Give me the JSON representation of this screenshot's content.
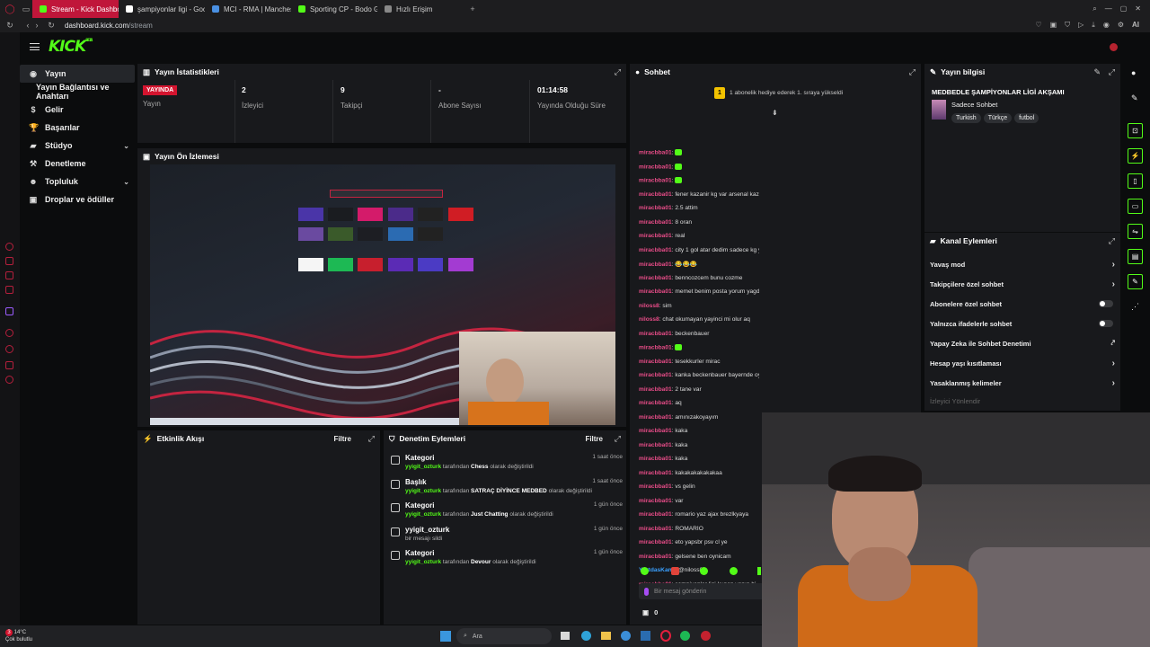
{
  "browser": {
    "tabs": [
      {
        "label": "Stream - Kick Dashboard",
        "active": true,
        "color": "#53fc18"
      },
      {
        "label": "şampiyonlar ligi - Google",
        "active": false,
        "color": "#ffffff"
      },
      {
        "label": "MCI - RMA | Manchester",
        "active": false,
        "color": "#4a90e2"
      },
      {
        "label": "Sporting CP - Bodo Glimt",
        "active": false,
        "color": "#53fc18"
      },
      {
        "label": "Hızlı Erişim",
        "active": false,
        "color": "#888888"
      }
    ],
    "url_host": "dashboard.kick.com",
    "url_path": "/stream"
  },
  "kick": {
    "logo": "KICK",
    "logo_badge": "BETA"
  },
  "leftnav": [
    {
      "label": "Yayın",
      "icon": "broadcast-icon",
      "selected": true
    },
    {
      "label": "Yayın Bağlantısı ve Anahtarı",
      "icon": "",
      "selected": false
    },
    {
      "label": "Gelir",
      "icon": "dollar-icon",
      "selected": false
    },
    {
      "label": "Başarılar",
      "icon": "trophy-icon",
      "selected": false
    },
    {
      "label": "Stüdyo",
      "icon": "studio-icon",
      "selected": false,
      "chevron": true
    },
    {
      "label": "Denetleme",
      "icon": "hammer-icon",
      "selected": false
    },
    {
      "label": "Topluluk",
      "icon": "community-icon",
      "selected": false,
      "chevron": true
    },
    {
      "label": "Droplar ve ödüller",
      "icon": "gift-icon",
      "selected": false
    }
  ],
  "stats": {
    "title": "Yayın İstatistikleri",
    "status_badge": "YAYINDA",
    "status_label": "Yayın",
    "viewers": "2",
    "viewers_label": "İzleyici",
    "followers": "9",
    "followers_label": "Takipçi",
    "subs": "-",
    "subs_label": "Abone Sayısı",
    "uptime": "01:14:58",
    "uptime_label": "Yayında Olduğu Süre"
  },
  "preview": {
    "title": "Yayın Ön İzlemesi"
  },
  "activity": {
    "title": "Etkinlik Akışı",
    "filter": "Filtre"
  },
  "mod": {
    "title": "Denetim Eylemleri",
    "filter": "Filtre",
    "items": [
      {
        "title": "Kategori",
        "user": "yyigit_ozturk",
        "mid": "tarafından",
        "value": "Chess",
        "end": "olarak değiştirildi",
        "time": "1 saat önce"
      },
      {
        "title": "Başlık",
        "user": "yyigit_ozturk",
        "mid": "tarafından",
        "value": "SATRAÇ DİYİNCE MEDBED",
        "end": "olarak değiştirildi",
        "time": "1 saat önce"
      },
      {
        "title": "Kategori",
        "user": "yyigit_ozturk",
        "mid": "tarafından",
        "value": "Just Chatting",
        "end": "olarak değiştirildi",
        "time": "1 gün önce"
      },
      {
        "title": "yyigit_ozturk",
        "user": "",
        "mid": "bir mesajı sildi",
        "value": "",
        "end": "",
        "time": "1 gün önce"
      },
      {
        "title": "Kategori",
        "user": "yyigit_ozturk",
        "mid": "tarafından",
        "value": "Devour",
        "end": "olarak değiştirildi",
        "time": "1 gün önce"
      }
    ]
  },
  "chat": {
    "title": "Sohbet",
    "pinned": "1 abonelik hediye ederek 1. sıraya yükseldi",
    "pinned_rank": "1",
    "messages": [
      {
        "user": "miracbba01",
        "text": "",
        "emote": true
      },
      {
        "user": "miracbba01",
        "text": "",
        "emote": true
      },
      {
        "user": "miracbba01",
        "text": "",
        "emote": true
      },
      {
        "user": "miracbba01",
        "text": "fener kazanir kg var arsenal kazanir 1.5 ust city 0.5 ust psg kg var",
        "emote": false
      },
      {
        "user": "miracbba01",
        "text": "2.5 attim",
        "emote": false
      },
      {
        "user": "miracbba01",
        "text": "8 oran",
        "emote": false
      },
      {
        "user": "miracbba01",
        "text": "real",
        "emote": false
      },
      {
        "user": "miracbba01",
        "text": "city 1 gol atar dedim sadece kg yok o maca",
        "emote": false
      },
      {
        "user": "miracbba01",
        "text": "😂😂😂",
        "emote": false
      },
      {
        "user": "miracbba01",
        "text": "benncozcem bunu cozme",
        "emote": false
      },
      {
        "user": "miracbba01",
        "text": "memet benim posta yorum yagdirlyo anlik senin elemanlar",
        "emote": false
      },
      {
        "user": "niloss8",
        "text": "sim",
        "emote": false
      },
      {
        "user": "niloss8",
        "text": "chat okumayan yayinci mi olur aq",
        "emote": false
      },
      {
        "user": "miracbba01",
        "text": "beckenbauer",
        "emote": false
      },
      {
        "user": "miracbba01",
        "text": "",
        "emote": true
      },
      {
        "user": "miracbba01",
        "text": "tesekkurler mirac",
        "emote": false
      },
      {
        "user": "miracbba01",
        "text": "kanka beckenbauer bayernde oynadi ballondoru da var aq",
        "emote": false
      },
      {
        "user": "miracbba01",
        "text": "2 tane var",
        "emote": false
      },
      {
        "user": "miracbba01",
        "text": "aq",
        "emote": false
      },
      {
        "user": "miracbba01",
        "text": "amınızakoyayım",
        "emote": false
      },
      {
        "user": "miracbba01",
        "text": "kaka",
        "emote": false
      },
      {
        "user": "miracbba01",
        "text": "kaka",
        "emote": false
      },
      {
        "user": "miracbba01",
        "text": "kaka",
        "emote": false
      },
      {
        "user": "miracbba01",
        "text": "kakakakakakakaa",
        "emote": false
      },
      {
        "user": "miracbba01",
        "text": "vs gelin",
        "emote": false
      },
      {
        "user": "miracbba01",
        "text": "var",
        "emote": false
      },
      {
        "user": "miracbba01",
        "text": "romario yaz ajax brezlkyaya",
        "emote": false
      },
      {
        "user": "miracbba01",
        "text": "ROMARİO",
        "emote": false
      },
      {
        "user": "miracbba01",
        "text": "eto yapsbr psv cl ye",
        "emote": false
      },
      {
        "user": "miracbba01",
        "text": "gelsene ben oynicam",
        "emote": false
      },
      {
        "user": "YurtdasKane",
        "text": "@niloss8",
        "emote": false,
        "alt": true
      },
      {
        "user": "miracbba01",
        "text": "şampiyonlar ligi kupon yapın bi",
        "emote": false
      }
    ],
    "placeholder": "Bir mesaj gönderin",
    "count": "0"
  },
  "info": {
    "title": "Yayın bilgisi",
    "stream_title": "MEDBEDLE ŞAMPİYONLAR LİGİ AKŞAMI",
    "category": "Sadece Sohbet",
    "tags": [
      "Turkish",
      "Türkçe",
      "futbol"
    ]
  },
  "channel_actions": {
    "title": "Kanal Eylemleri",
    "items": [
      {
        "label": "Yavaş mod",
        "type": "chevron"
      },
      {
        "label": "Takipçilere özel sohbet",
        "type": "chevron"
      },
      {
        "label": "Abonelere özel sohbet",
        "type": "toggle"
      },
      {
        "label": "Yalnızca ifadelerle sohbet",
        "type": "toggle"
      },
      {
        "label": "Yapay Zeka ile Sohbet Denetimi",
        "type": "external"
      },
      {
        "label": "Hesap yaşı kısıtlaması",
        "type": "chevron"
      },
      {
        "label": "Yasaklanmış kelimeler",
        "type": "chevron"
      }
    ],
    "faded": "İzleyici Yönlendir"
  },
  "taskbar": {
    "weather_temp": "14°C",
    "weather_text": "Çok bulutlu",
    "search": "Ara",
    "notif": "3"
  },
  "colors": {
    "kick_green": "#53fc18",
    "live_red": "#d4142f",
    "tab_active": "#c0163a"
  }
}
